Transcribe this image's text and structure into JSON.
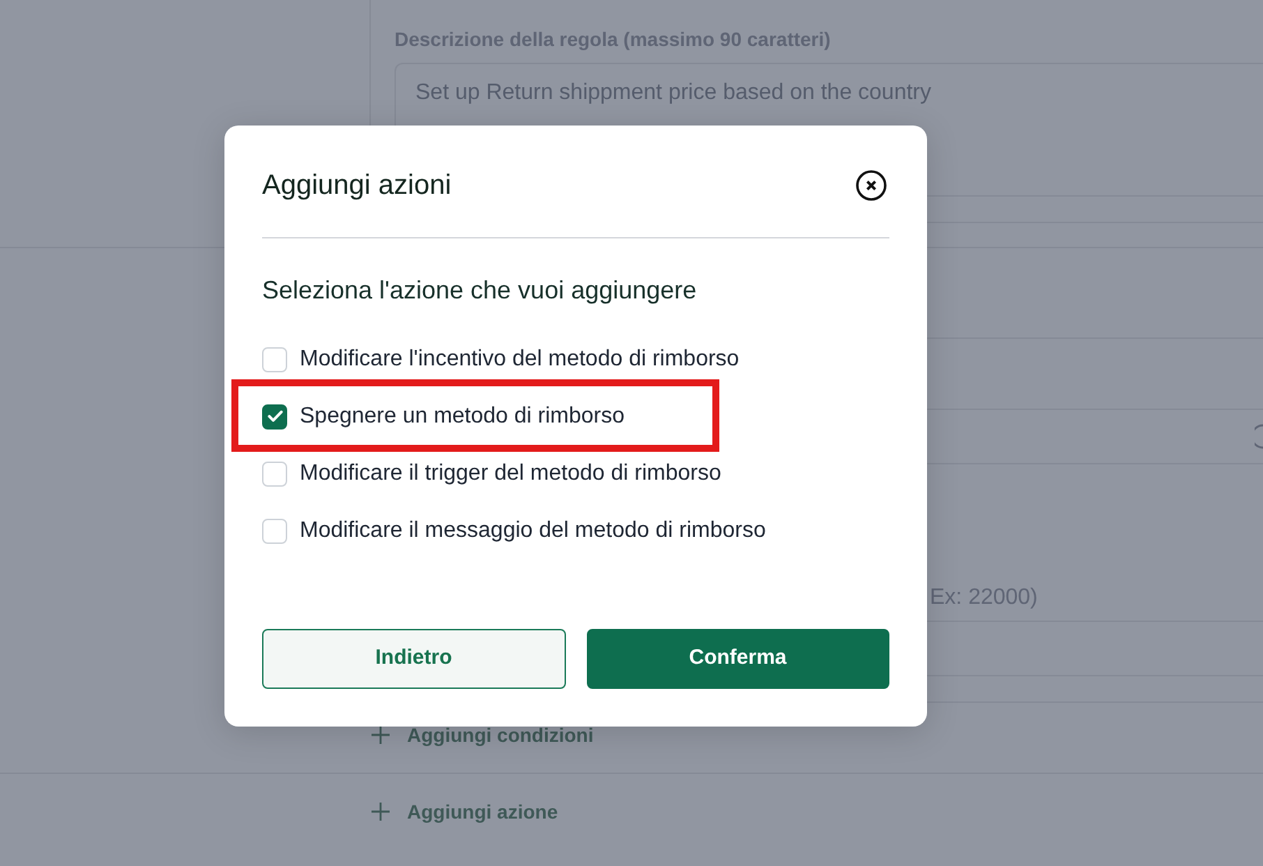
{
  "page": {
    "description_label": "Descrizione della regola (massimo 90 caratteri)",
    "description_value": "Set up Return shippment price based on the country",
    "field_placeholder": "Ex: 22000)",
    "add_conditions": "Aggiungi condizioni",
    "add_action": "Aggiungi azione"
  },
  "dialog": {
    "title": "Aggiungi azioni",
    "prompt": "Seleziona l'azione che vuoi aggiungere",
    "options": [
      {
        "label": "Modificare l'incentivo del metodo di rimborso",
        "checked": false,
        "highlighted": false
      },
      {
        "label": "Spegnere un metodo di rimborso",
        "checked": true,
        "highlighted": true
      },
      {
        "label": "Modificare il trigger del metodo di rimborso",
        "checked": false,
        "highlighted": false
      },
      {
        "label": "Modificare il messaggio del metodo di rimborso",
        "checked": false,
        "highlighted": false
      }
    ],
    "buttons": [
      {
        "label": "Indietro",
        "kind": "secondary"
      },
      {
        "label": "Conferma",
        "kind": "primary"
      }
    ]
  }
}
